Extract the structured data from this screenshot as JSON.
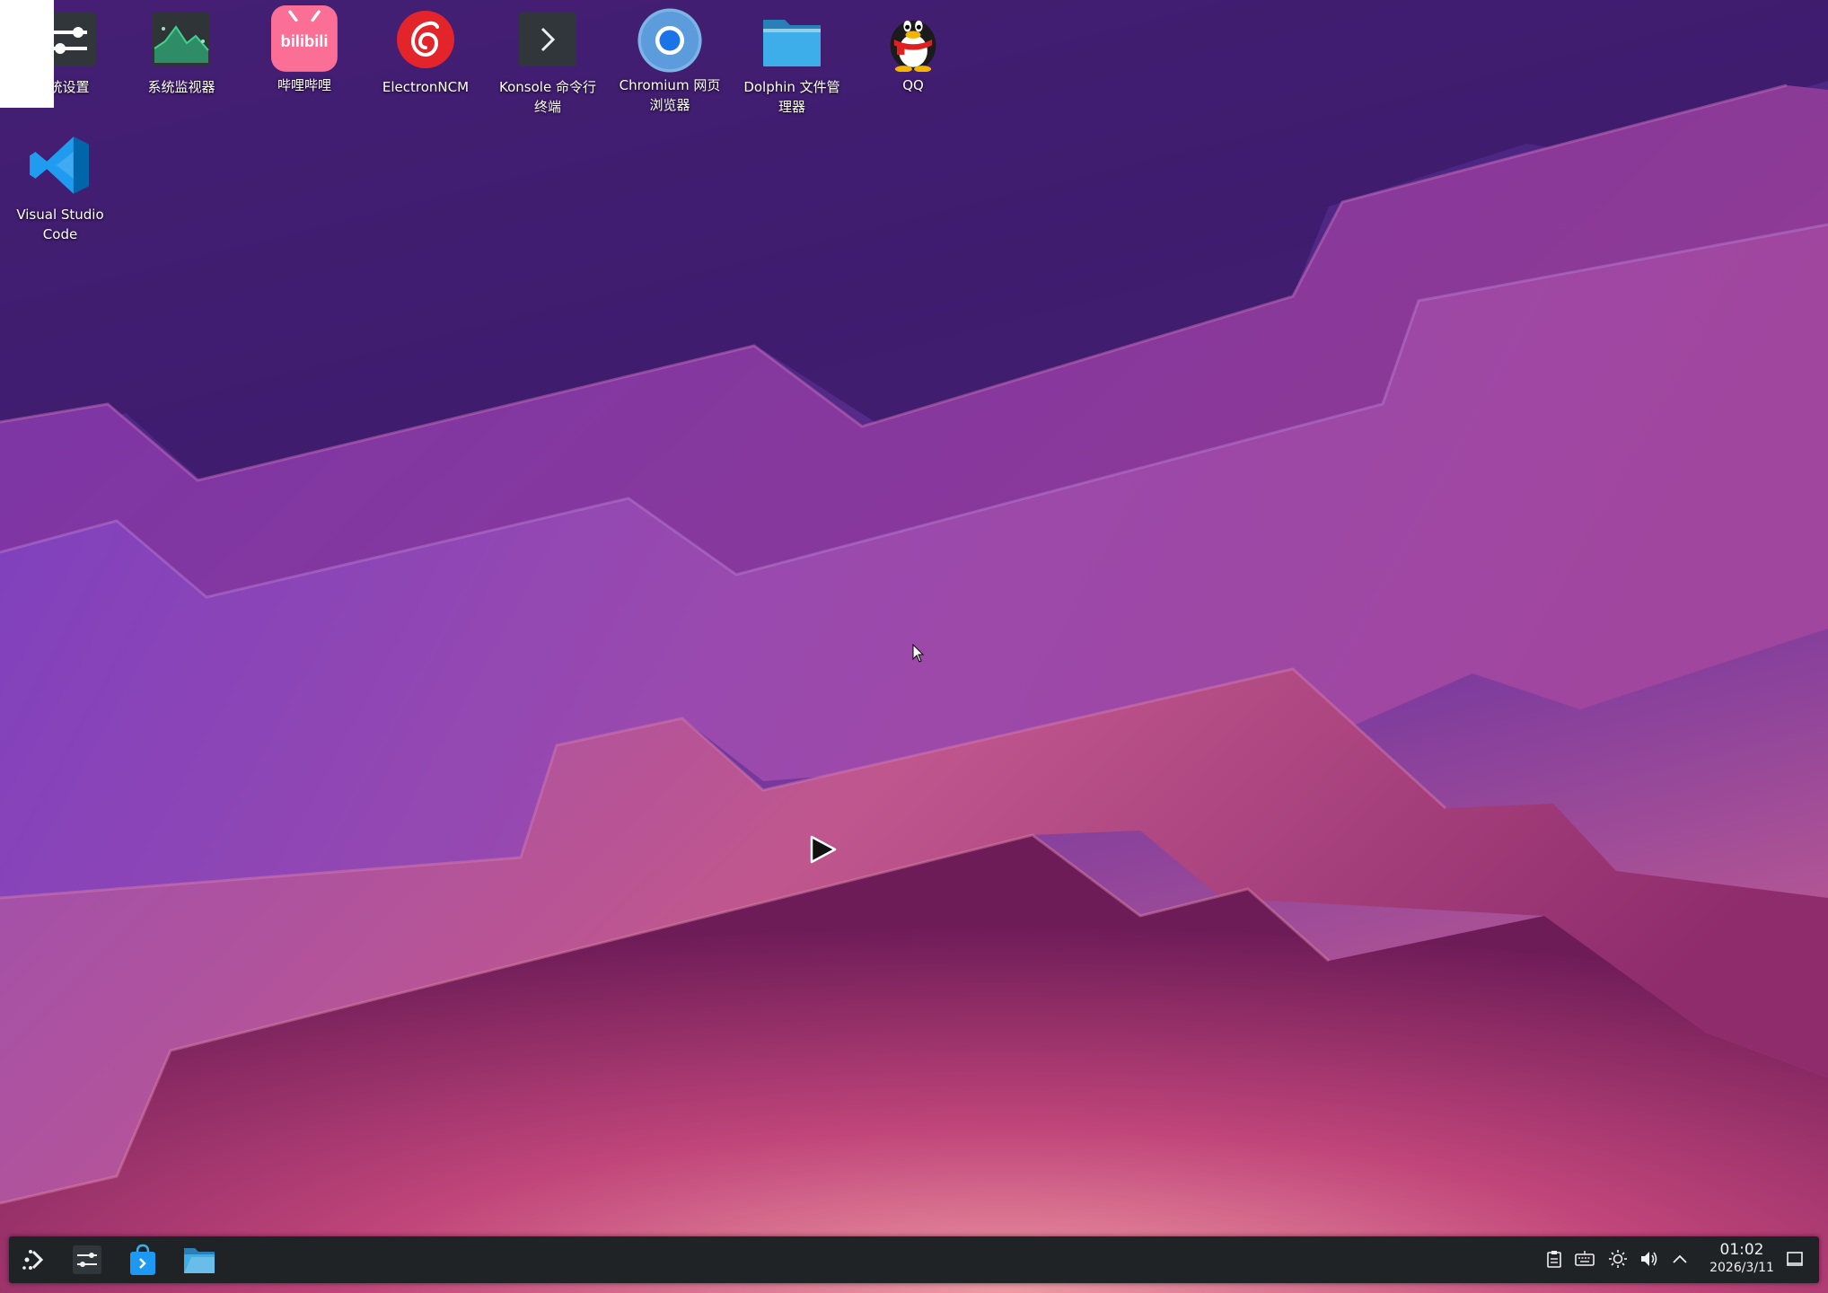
{
  "desktop": {
    "icons": [
      {
        "name": "settings",
        "label": "统设置",
        "icon": "system-settings-icon"
      },
      {
        "name": "system-monitor",
        "label": "系统监视器",
        "icon": "system-monitor-icon"
      },
      {
        "name": "bilibili",
        "label": "哔哩哔哩",
        "icon": "bilibili-icon",
        "glyph_text": "bilibili"
      },
      {
        "name": "electron-ncm",
        "label": "ElectronNCM",
        "icon": "netease-music-icon"
      },
      {
        "name": "konsole",
        "label": "Konsole 命令行\n终端",
        "icon": "terminal-icon"
      },
      {
        "name": "chromium",
        "label": "Chromium 网页\n浏览器",
        "icon": "chromium-icon"
      },
      {
        "name": "dolphin",
        "label": "Dolphin 文件管\n理器",
        "icon": "folder-icon"
      },
      {
        "name": "qq",
        "label": "QQ",
        "icon": "qq-penguin-icon"
      },
      {
        "name": "vscode",
        "label": "Visual Studio\nCode",
        "icon": "vscode-icon"
      }
    ]
  },
  "taskbar": {
    "launcher_icon": "application-launcher-icon",
    "pinned": [
      {
        "name": "system-settings",
        "icon": "settings-sliders-icon"
      },
      {
        "name": "discover-store",
        "icon": "store-bag-icon"
      },
      {
        "name": "file-manager",
        "icon": "folder-icon"
      }
    ],
    "tray": [
      "clipboard-icon",
      "keyboard-icon",
      "brightness-icon",
      "volume-icon",
      "chevron-up-icon"
    ],
    "clock": {
      "time": "01:02",
      "date": "2026/3/11"
    },
    "show_desktop_icon": "show-desktop-icon"
  },
  "colors": {
    "wallpaper_top": "#3f1f70",
    "wallpaper_mid": "#8a3fae",
    "wallpaper_bottom": "#e58a9c",
    "taskbar": "#202326",
    "accent": "#3daee9"
  }
}
